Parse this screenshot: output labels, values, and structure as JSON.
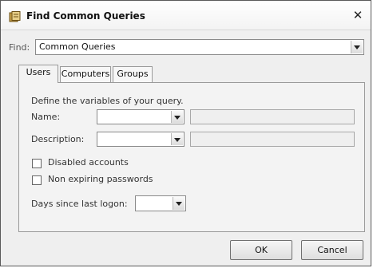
{
  "window": {
    "title": "Find Common Queries",
    "close_symbol": "✕"
  },
  "find": {
    "label": "Find:",
    "value": "Common Queries"
  },
  "tabs": [
    {
      "label": "Users",
      "active": true
    },
    {
      "label": "Computers",
      "active": false
    },
    {
      "label": "Groups",
      "active": false
    }
  ],
  "users_panel": {
    "instruction": "Define the variables of your query.",
    "name_label": "Name:",
    "name_operator": "",
    "name_value": "",
    "description_label": "Description:",
    "description_operator": "",
    "description_value": "",
    "disabled_accounts_label": "Disabled accounts",
    "disabled_accounts_checked": false,
    "non_expiring_label": "Non expiring passwords",
    "non_expiring_checked": false,
    "days_since_logon_label": "Days since last logon:",
    "days_since_logon_value": ""
  },
  "buttons": {
    "ok": "OK",
    "cancel": "Cancel"
  },
  "icons": {
    "title": "find-queries-icon",
    "dropdown": "chevron-down-icon"
  }
}
